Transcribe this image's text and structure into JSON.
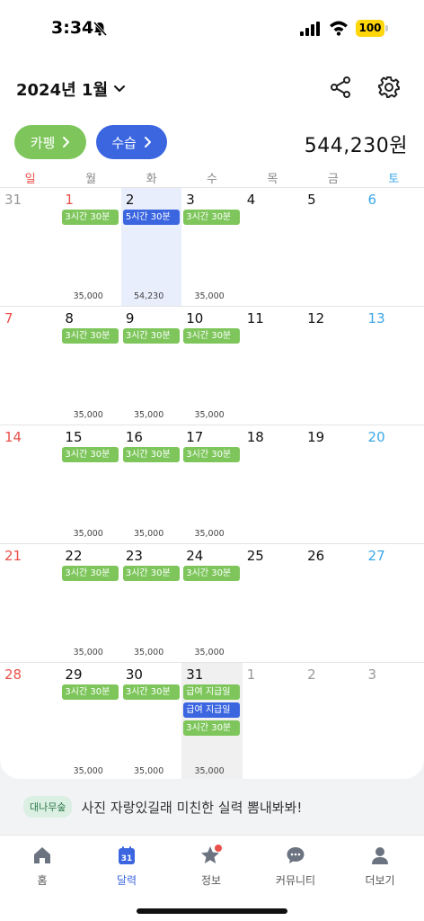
{
  "status": {
    "time": "3:34",
    "battery": "100"
  },
  "header": {
    "title": "2024년 1월"
  },
  "buttons": {
    "cafe": "카펭",
    "income": "수습"
  },
  "total": "544,230원",
  "weekdays": [
    "일",
    "월",
    "화",
    "수",
    "목",
    "금",
    "토"
  ],
  "weeks": [
    [
      {
        "day": "31",
        "kind": "other",
        "tags": [],
        "amount": ""
      },
      {
        "day": "1",
        "kind": "sun",
        "tags": [
          {
            "text": "3시간 30분",
            "color": "green"
          }
        ],
        "amount": "35,000"
      },
      {
        "day": "2",
        "kind": "today",
        "tags": [
          {
            "text": "5시간 30분",
            "color": "blue"
          }
        ],
        "amount": "54,230"
      },
      {
        "day": "3",
        "kind": "",
        "tags": [
          {
            "text": "3시간 30분",
            "color": "green"
          }
        ],
        "amount": "35,000"
      },
      {
        "day": "4",
        "kind": "",
        "tags": [],
        "amount": ""
      },
      {
        "day": "5",
        "kind": "",
        "tags": [],
        "amount": ""
      },
      {
        "day": "6",
        "kind": "sat",
        "tags": [],
        "amount": ""
      }
    ],
    [
      {
        "day": "7",
        "kind": "sun",
        "tags": [],
        "amount": ""
      },
      {
        "day": "8",
        "kind": "",
        "tags": [
          {
            "text": "3시간 30분",
            "color": "green"
          }
        ],
        "amount": "35,000"
      },
      {
        "day": "9",
        "kind": "",
        "tags": [
          {
            "text": "3시간 30분",
            "color": "green"
          }
        ],
        "amount": "35,000"
      },
      {
        "day": "10",
        "kind": "",
        "tags": [
          {
            "text": "3시간 30분",
            "color": "green"
          }
        ],
        "amount": "35,000"
      },
      {
        "day": "11",
        "kind": "",
        "tags": [],
        "amount": ""
      },
      {
        "day": "12",
        "kind": "",
        "tags": [],
        "amount": ""
      },
      {
        "day": "13",
        "kind": "sat",
        "tags": [],
        "amount": ""
      }
    ],
    [
      {
        "day": "14",
        "kind": "sun",
        "tags": [],
        "amount": ""
      },
      {
        "day": "15",
        "kind": "",
        "tags": [
          {
            "text": "3시간 30분",
            "color": "green"
          }
        ],
        "amount": "35,000"
      },
      {
        "day": "16",
        "kind": "",
        "tags": [
          {
            "text": "3시간 30분",
            "color": "green"
          }
        ],
        "amount": "35,000"
      },
      {
        "day": "17",
        "kind": "",
        "tags": [
          {
            "text": "3시간 30분",
            "color": "green"
          }
        ],
        "amount": "35,000"
      },
      {
        "day": "18",
        "kind": "",
        "tags": [],
        "amount": ""
      },
      {
        "day": "19",
        "kind": "",
        "tags": [],
        "amount": ""
      },
      {
        "day": "20",
        "kind": "sat",
        "tags": [],
        "amount": ""
      }
    ],
    [
      {
        "day": "21",
        "kind": "sun",
        "tags": [],
        "amount": ""
      },
      {
        "day": "22",
        "kind": "",
        "tags": [
          {
            "text": "3시간 30분",
            "color": "green"
          }
        ],
        "amount": "35,000"
      },
      {
        "day": "23",
        "kind": "",
        "tags": [
          {
            "text": "3시간 30분",
            "color": "green"
          }
        ],
        "amount": "35,000"
      },
      {
        "day": "24",
        "kind": "",
        "tags": [
          {
            "text": "3시간 30분",
            "color": "green"
          }
        ],
        "amount": "35,000"
      },
      {
        "day": "25",
        "kind": "",
        "tags": [],
        "amount": ""
      },
      {
        "day": "26",
        "kind": "",
        "tags": [],
        "amount": ""
      },
      {
        "day": "27",
        "kind": "sat",
        "tags": [],
        "amount": ""
      }
    ],
    [
      {
        "day": "28",
        "kind": "sun",
        "tags": [],
        "amount": ""
      },
      {
        "day": "29",
        "kind": "",
        "tags": [
          {
            "text": "3시간 30분",
            "color": "green"
          }
        ],
        "amount": "35,000"
      },
      {
        "day": "30",
        "kind": "",
        "tags": [
          {
            "text": "3시간 30분",
            "color": "green"
          }
        ],
        "amount": "35,000"
      },
      {
        "day": "31",
        "kind": "shaded",
        "tags": [
          {
            "text": "급여 지급일",
            "color": "green"
          },
          {
            "text": "급여 지급일",
            "color": "blue"
          },
          {
            "text": "3시간 30분",
            "color": "green"
          }
        ],
        "amount": "35,000"
      },
      {
        "day": "1",
        "kind": "other",
        "tags": [],
        "amount": ""
      },
      {
        "day": "2",
        "kind": "other",
        "tags": [],
        "amount": ""
      },
      {
        "day": "3",
        "kind": "other",
        "tags": [],
        "amount": ""
      }
    ]
  ],
  "banner": {
    "badge": "대나무숲",
    "text": "사진 자랑있길래 미친한 실력 뽐내봐봐!"
  },
  "tabs": [
    {
      "label": "홈",
      "icon": "home-icon",
      "active": false
    },
    {
      "label": "달력",
      "icon": "calendar-icon",
      "active": true,
      "badge_number": "31"
    },
    {
      "label": "정보",
      "icon": "star-icon",
      "active": false
    },
    {
      "label": "커뮤니티",
      "icon": "chat-icon",
      "active": false
    },
    {
      "label": "더보기",
      "icon": "person-icon",
      "active": false
    }
  ],
  "colors": {
    "green": "#7ec65c",
    "blue": "#3b66e0",
    "sunday": "#e9504a",
    "saturday": "#3aa7e8",
    "today_bg": "#e8eefc"
  }
}
